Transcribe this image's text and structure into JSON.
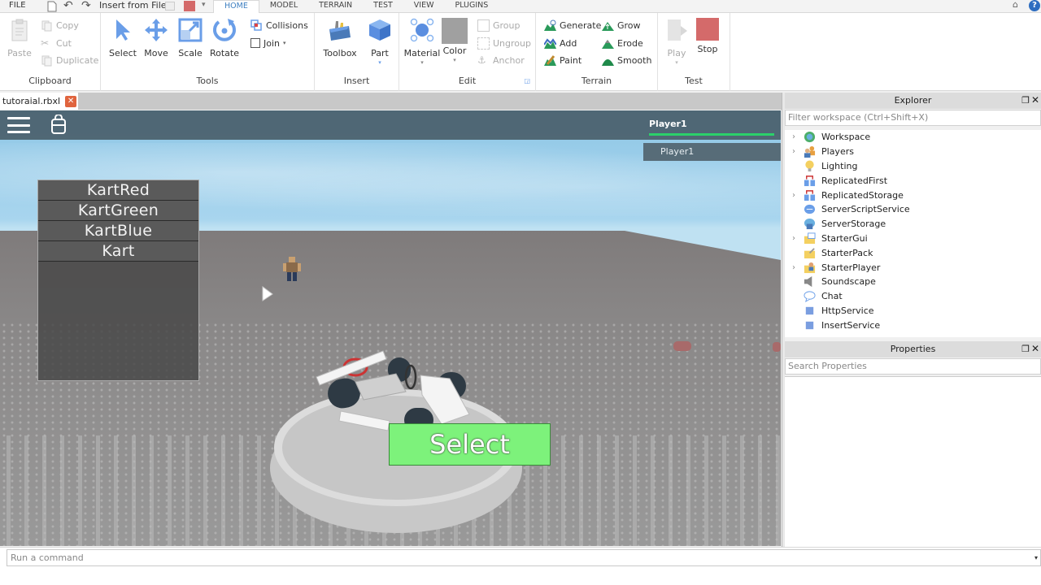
{
  "menubar": {
    "file_label": "FILE",
    "quick_access_text": "Insert from File",
    "tabs": [
      {
        "label": "HOME",
        "active": true
      },
      {
        "label": "MODEL",
        "active": false
      },
      {
        "label": "TERRAIN",
        "active": false
      },
      {
        "label": "TEST",
        "active": false
      },
      {
        "label": "VIEW",
        "active": false
      },
      {
        "label": "PLUGINS",
        "active": false
      }
    ]
  },
  "ribbon": {
    "clipboard": {
      "label": "Clipboard",
      "paste": "Paste",
      "copy": "Copy",
      "cut": "Cut",
      "duplicate": "Duplicate"
    },
    "tools": {
      "label": "Tools",
      "select": "Select",
      "move": "Move",
      "scale": "Scale",
      "rotate": "Rotate",
      "collisions": "Collisions",
      "join": "Join"
    },
    "insert": {
      "label": "Insert",
      "toolbox": "Toolbox",
      "part": "Part"
    },
    "edit": {
      "label": "Edit",
      "material": "Material",
      "color": "Color",
      "group": "Group",
      "ungroup": "Ungroup",
      "anchor": "Anchor"
    },
    "terrain": {
      "label": "Terrain",
      "generate": "Generate",
      "add": "Add",
      "paint": "Paint",
      "grow": "Grow",
      "erode": "Erode",
      "smooth": "Smooth"
    },
    "test": {
      "label": "Test",
      "play": "Play",
      "stop": "Stop"
    },
    "colors": {
      "accent": "#3d7fc1",
      "stop": "#d46a6a",
      "color_swatch": "#a0a0a0"
    }
  },
  "document": {
    "tab_name": "tutoraial.rbxl"
  },
  "game": {
    "leaderboard": {
      "player_header": "Player1",
      "rows": [
        "Player1"
      ]
    },
    "kart_list": [
      "KartRed",
      "KartGreen",
      "KartBlue",
      "Kart"
    ],
    "select_button": "Select",
    "colors": {
      "select_button": "#7df27b",
      "health_bar": "#2bd16a"
    }
  },
  "explorer": {
    "title": "Explorer",
    "filter_placeholder": "Filter workspace (Ctrl+Shift+X)",
    "items": [
      {
        "label": "Workspace",
        "expandable": true,
        "icon": "globe-icon"
      },
      {
        "label": "Players",
        "expandable": true,
        "icon": "players-icon"
      },
      {
        "label": "Lighting",
        "expandable": false,
        "icon": "lightbulb-icon"
      },
      {
        "label": "ReplicatedFirst",
        "expandable": false,
        "icon": "replicated-icon"
      },
      {
        "label": "ReplicatedStorage",
        "expandable": true,
        "icon": "replicated-icon"
      },
      {
        "label": "ServerScriptService",
        "expandable": false,
        "icon": "server-script-icon"
      },
      {
        "label": "ServerStorage",
        "expandable": false,
        "icon": "server-storage-icon"
      },
      {
        "label": "StarterGui",
        "expandable": true,
        "icon": "folder-gui-icon"
      },
      {
        "label": "StarterPack",
        "expandable": false,
        "icon": "folder-pack-icon"
      },
      {
        "label": "StarterPlayer",
        "expandable": true,
        "icon": "folder-player-icon"
      },
      {
        "label": "Soundscape",
        "expandable": false,
        "icon": "speaker-icon"
      },
      {
        "label": "Chat",
        "expandable": false,
        "icon": "chat-icon"
      },
      {
        "label": "HttpService",
        "expandable": false,
        "icon": "service-icon"
      },
      {
        "label": "InsertService",
        "expandable": false,
        "icon": "service-icon"
      }
    ]
  },
  "properties": {
    "title": "Properties",
    "search_placeholder": "Search Properties"
  },
  "command_bar": {
    "placeholder": "Run a command"
  }
}
